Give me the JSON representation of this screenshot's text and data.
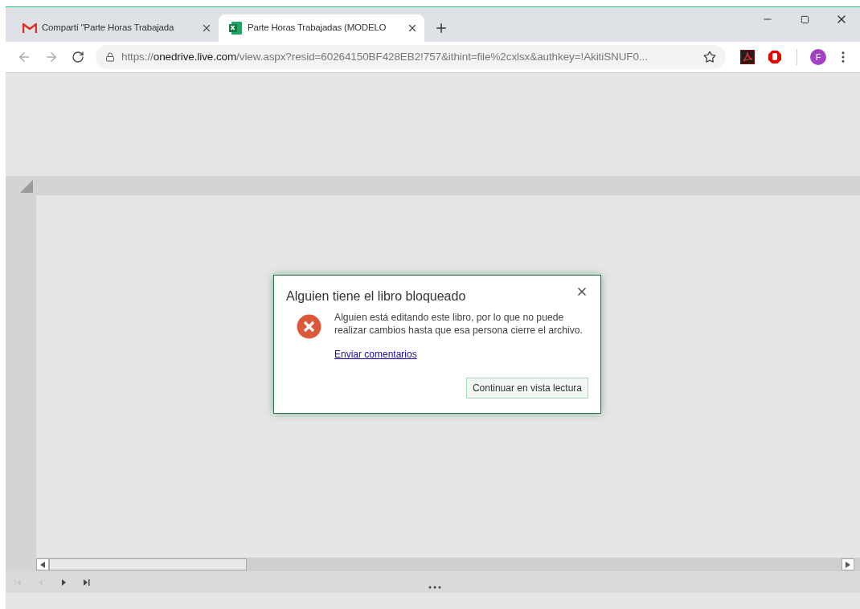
{
  "tabs": [
    {
      "kind": "gmail",
      "title": "Compartí \"Parte Horas Trabajada",
      "selected": false
    },
    {
      "kind": "excel",
      "title": "Parte Horas Trabajadas (MODELO",
      "selected": true
    }
  ],
  "address": {
    "scheme": "https://",
    "host": "onedrive.live.com",
    "path": "/view.aspx?resid=60264150BF428EB2!757&ithint=file%2cxlsx&authkey=!AkitiSNUF0..."
  },
  "profile": {
    "initial": "F"
  },
  "sheet_nav": [
    {
      "kind": "first",
      "disabled": true
    },
    {
      "kind": "prev",
      "disabled": true
    },
    {
      "kind": "next",
      "disabled": false
    },
    {
      "kind": "last",
      "disabled": false
    }
  ],
  "dialog": {
    "title": "Alguien tiene el libro bloqueado",
    "message": "Alguien está editando este libro, por lo que no puede realizar cambios hasta que esa persona cierre el archivo.",
    "link": "Enviar comentarios",
    "button": "Continuar en vista lectura"
  }
}
